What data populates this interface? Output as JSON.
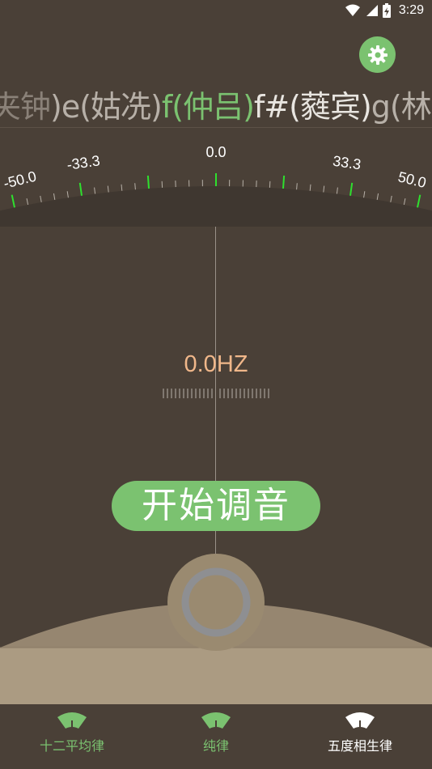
{
  "status_bar": {
    "time": "3:29"
  },
  "note_strip": {
    "notes": [
      {
        "text": "夹钟",
        "tone": "dim"
      },
      {
        "text": ")e(姑冼)",
        "tone": "mid"
      },
      {
        "text": " f(仲吕)",
        "tone": "active"
      },
      {
        "text": "f#(蕤宾)",
        "tone": "light"
      },
      {
        "text": "g(林",
        "tone": "mid"
      }
    ]
  },
  "gauge": {
    "labels": [
      "-50.0",
      "-33.3",
      "0.0",
      "33.3",
      "50.0"
    ],
    "tick_color": "#2ee02e",
    "minor_tick_color": "#b7b0a8"
  },
  "frequency": {
    "readout": "0.0HZ"
  },
  "start_button": {
    "label": "开始调音"
  },
  "bottom_nav": {
    "items": [
      {
        "label": "十二平均律",
        "active": false
      },
      {
        "label": "纯律",
        "active": false
      },
      {
        "label": "五度相生律",
        "active": true
      }
    ]
  },
  "colors": {
    "accent_green": "#7bc270",
    "background": "#4a4037",
    "base_color": "#9a8a70",
    "freq_color": "#f0b78a"
  }
}
